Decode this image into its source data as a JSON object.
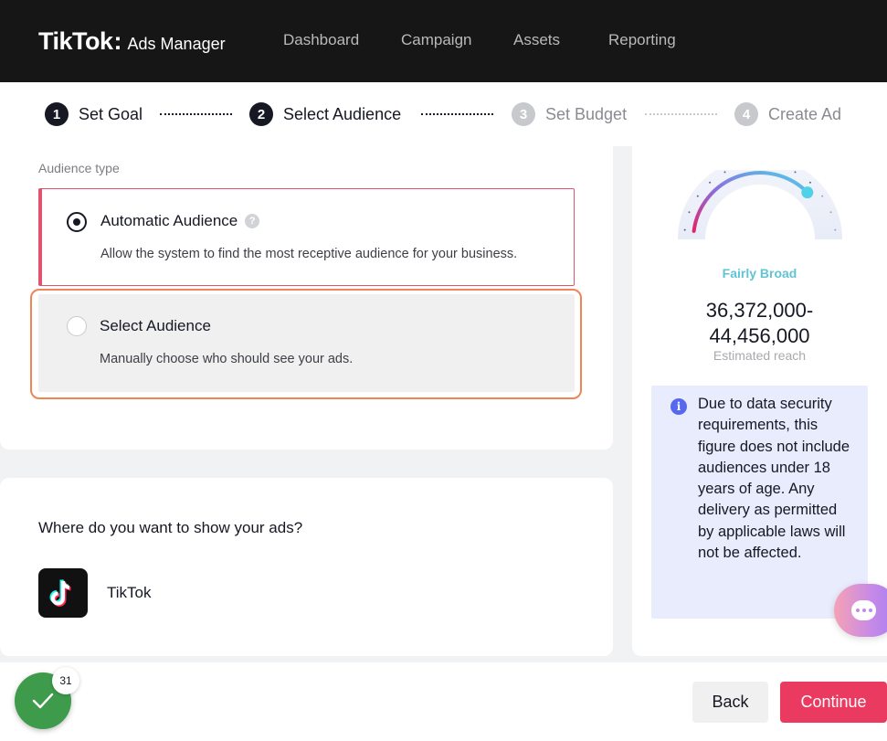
{
  "header": {
    "brand": "TikTok",
    "product": "Ads Manager",
    "nav": [
      {
        "label": "Dashboard"
      },
      {
        "label": "Campaign"
      },
      {
        "label": "Assets"
      },
      {
        "label": "Reporting"
      }
    ]
  },
  "stepper": {
    "steps": [
      {
        "num": "1",
        "label": "Set Goal",
        "state": "complete"
      },
      {
        "num": "2",
        "label": "Select Audience",
        "state": "current"
      },
      {
        "num": "3",
        "label": "Set Budget",
        "state": "upcoming"
      },
      {
        "num": "4",
        "label": "Create Ad",
        "state": "upcoming"
      }
    ]
  },
  "audience": {
    "section_label": "Audience type",
    "options": [
      {
        "title": "Automatic Audience",
        "help": "?",
        "description": "Allow the system to find the most receptive audience for your business.",
        "selected": true
      },
      {
        "title": "Select Audience",
        "description": "Manually choose who should see your ads.",
        "selected": false
      }
    ]
  },
  "placement": {
    "question": "Where do you want to show your ads?",
    "platform": "TikTok"
  },
  "reach": {
    "level": "Fairly Broad",
    "range_line1": "36,372,000-",
    "range_line2": "44,456,000",
    "caption": "Estimated reach",
    "gauge_fraction": 0.78,
    "notice_icon": "i",
    "notice": "Due to data security requirements, this figure does not include audiences under 18 years of age. Any delivery as permitted by applicable laws will not be affected."
  },
  "footer": {
    "back_label": "Back",
    "continue_label": "Continue",
    "progress_count": "31"
  },
  "colors": {
    "accent": "#ea3a5f",
    "focus_ring": "#ef8456",
    "gauge_level": "#62c3d4",
    "info": "#5568ee",
    "success": "#3f9b4c"
  }
}
